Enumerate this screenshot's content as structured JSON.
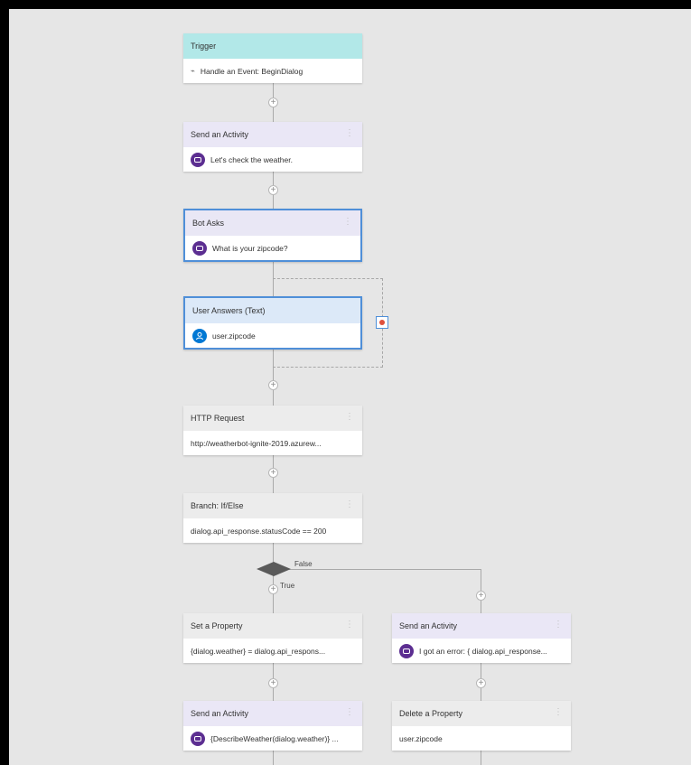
{
  "trigger": {
    "header": "Trigger",
    "body": "Handle an Event: BeginDialog",
    "icon": "event-icon"
  },
  "send_activity_1": {
    "header": "Send an Activity",
    "body": "Let's check the weather."
  },
  "bot_asks": {
    "header": "Bot Asks",
    "body": "What is your zipcode?"
  },
  "user_answers": {
    "header": "User Answers (Text)",
    "body": "user.zipcode"
  },
  "http_request": {
    "header": "HTTP Request",
    "body": "http://weatherbot-ignite-2019.azurew..."
  },
  "branch": {
    "header": "Branch: If/Else",
    "body": "dialog.api_response.statusCode == 200"
  },
  "branch_labels": {
    "true": "True",
    "false": "False"
  },
  "set_property": {
    "header": "Set a Property",
    "body": "{dialog.weather} = dialog.api_respons..."
  },
  "send_activity_2": {
    "header": "Send an Activity",
    "body": "{DescribeWeather(dialog.weather)} ..."
  },
  "send_activity_error": {
    "header": "Send an Activity",
    "body": "I got an error: { dialog.api_response..."
  },
  "delete_property": {
    "header": "Delete a Property",
    "body": "user.zipcode"
  },
  "more_glyph": "⋮",
  "plus_glyph": "+",
  "colors": {
    "canvas": "#e6e6e6",
    "trigger": "#b2e8e8",
    "selected_border": "#4f8fd8",
    "bot_icon": "#5c2e91",
    "user_icon": "#0078d4",
    "error_dot": "#e0503b"
  }
}
